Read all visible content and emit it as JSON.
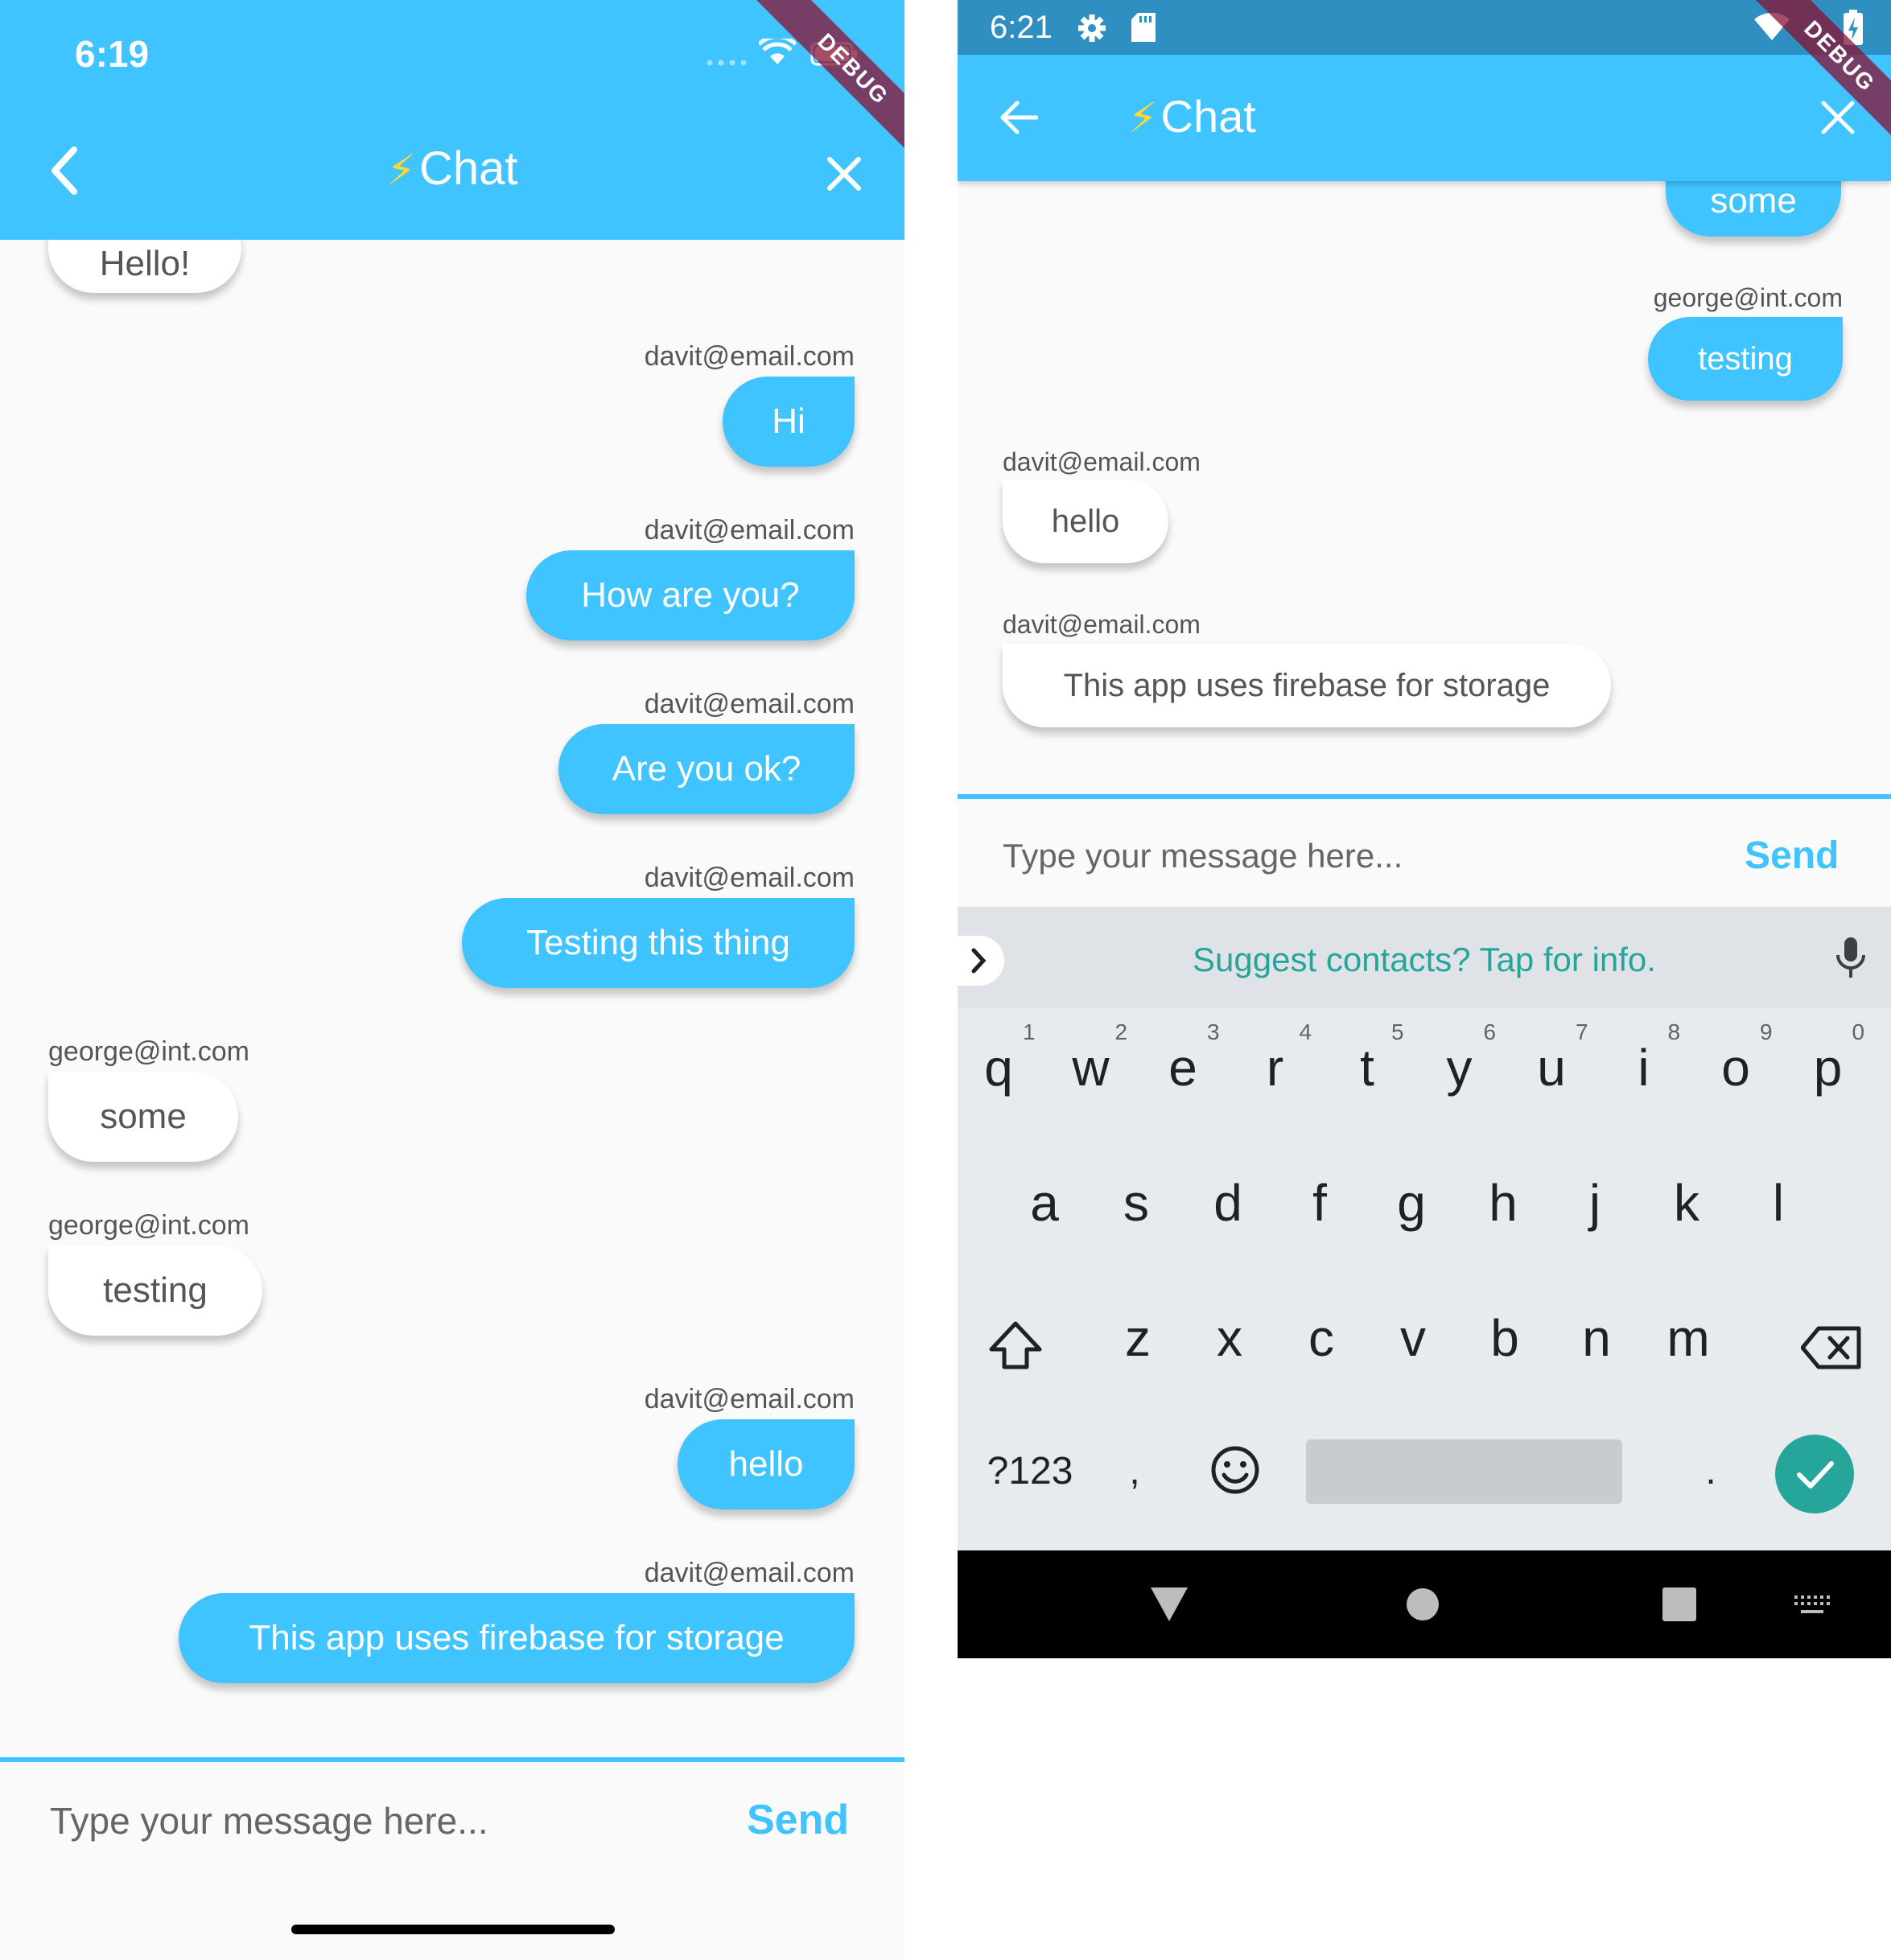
{
  "ios": {
    "status_time": "6:19",
    "title": "Chat",
    "debug_label": "DEBUG",
    "partial_top_message": "Hello!",
    "messages": [
      {
        "sender": "davit@email.com",
        "text": "Hi",
        "mine": true
      },
      {
        "sender": "davit@email.com",
        "text": "How are you?",
        "mine": true
      },
      {
        "sender": "davit@email.com",
        "text": "Are you ok?",
        "mine": true
      },
      {
        "sender": "davit@email.com",
        "text": "Testing this thing",
        "mine": true
      },
      {
        "sender": "george@int.com",
        "text": "some",
        "mine": false
      },
      {
        "sender": "george@int.com",
        "text": "testing",
        "mine": false
      },
      {
        "sender": "davit@email.com",
        "text": "hello",
        "mine": true
      },
      {
        "sender": "davit@email.com",
        "text": "This app uses firebase for storage",
        "mine": true
      }
    ],
    "input_placeholder": "Type your message here...",
    "send_label": "Send"
  },
  "android": {
    "status_time": "6:21",
    "title": "Chat",
    "debug_label": "DEBUG",
    "partial_top_message": "some",
    "messages": [
      {
        "sender": "george@int.com",
        "text": "testing",
        "mine": true
      },
      {
        "sender": "davit@email.com",
        "text": "hello",
        "mine": false
      },
      {
        "sender": "davit@email.com",
        "text": "This app uses firebase for storage",
        "mine": false
      }
    ],
    "input_placeholder": "Type your message here...",
    "send_label": "Send",
    "keyboard": {
      "suggestion": "Suggest contacts? Tap for info.",
      "row1": [
        "q",
        "w",
        "e",
        "r",
        "t",
        "y",
        "u",
        "i",
        "o",
        "p"
      ],
      "row1_hints": [
        "1",
        "2",
        "3",
        "4",
        "5",
        "6",
        "7",
        "8",
        "9",
        "0"
      ],
      "row2": [
        "a",
        "s",
        "d",
        "f",
        "g",
        "h",
        "j",
        "k",
        "l"
      ],
      "row3": [
        "z",
        "x",
        "c",
        "v",
        "b",
        "n",
        "m"
      ],
      "symbols_key": "?123",
      "comma_key": ",",
      "period_key": "."
    }
  },
  "colors": {
    "accent": "#40c4ff",
    "status_bar_android": "#2f8fc0",
    "bolt": "#fdd835",
    "keyboard_accent": "#26a69a"
  }
}
